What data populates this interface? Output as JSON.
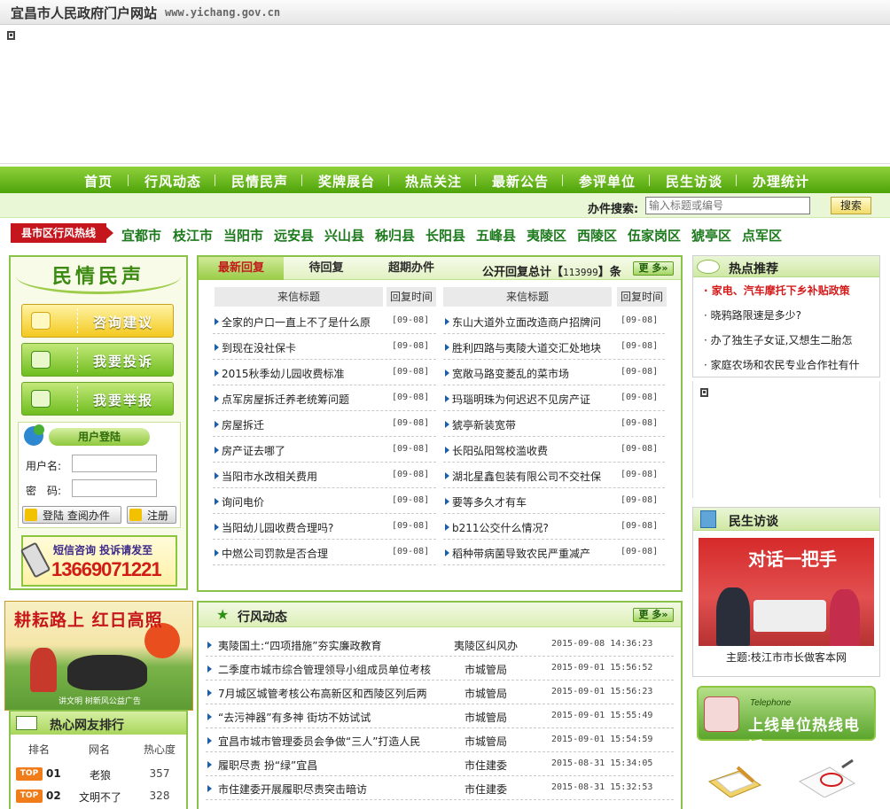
{
  "header": {
    "title": "宜昌市人民政府门户网站",
    "url": "www.yichang.gov.cn"
  },
  "nav": {
    "items": [
      "首页",
      "行风动态",
      "民情民声",
      "奖牌展台",
      "热点关注",
      "最新公告",
      "参评单位",
      "民生访谈",
      "办理统计"
    ]
  },
  "search": {
    "label": "办件搜索:",
    "placeholder": "输入标题或编号",
    "button": "搜索"
  },
  "county": {
    "tag": "县市区行风热线",
    "items": [
      "宜都市",
      "枝江市",
      "当阳市",
      "远安县",
      "兴山县",
      "秭归县",
      "长阳县",
      "五峰县",
      "夷陵区",
      "西陵区",
      "伍家岗区",
      "猇亭区",
      "点军区"
    ]
  },
  "left": {
    "title": "民情民声",
    "buttons": [
      "咨询建议",
      "我要投诉",
      "我要举报"
    ],
    "login": {
      "title": "用户登陆",
      "username_label": "用户名:",
      "password_label": "密　码:",
      "query_button": "登陆 查阅办件",
      "register_button": "注册"
    },
    "sms": {
      "line1": "短信咨询 投诉请发至",
      "number": "13669071221"
    },
    "poster": {
      "title": "耕耘路上 红日高照",
      "footer": "讲文明 树新风公益广告"
    }
  },
  "ranking": {
    "title": "热心网友排行",
    "columns": [
      "排名",
      "网名",
      "热心度"
    ],
    "badge": "TOP",
    "rows": [
      {
        "rank": "01",
        "name": "老狼",
        "score": "357"
      },
      {
        "rank": "02",
        "name": "文明不了",
        "score": "328"
      }
    ]
  },
  "letters": {
    "tabs": [
      "最新回复",
      "待回复",
      "超期办件"
    ],
    "total_prefix": "公开回复总计【",
    "total": "113999",
    "total_suffix": "】条",
    "more": "更 多»",
    "head_title": "来信标题",
    "head_time": "回复时间",
    "left": [
      {
        "title": "全家的户口一直上不了是什么原",
        "date": "[09-08]"
      },
      {
        "title": "到现在没社保卡",
        "date": "[09-08]"
      },
      {
        "title": "2015秋季幼儿园收费标准",
        "date": "[09-08]"
      },
      {
        "title": "点军房屋拆迁养老统筹问题",
        "date": "[09-08]"
      },
      {
        "title": "房屋拆迁",
        "date": "[09-08]"
      },
      {
        "title": "房产证去哪了",
        "date": "[09-08]"
      },
      {
        "title": "当阳市水改相关费用",
        "date": "[09-08]"
      },
      {
        "title": "询问电价",
        "date": "[09-08]"
      },
      {
        "title": "当阳幼儿园收费合理吗?",
        "date": "[09-08]"
      },
      {
        "title": "中燃公司罚款是否合理",
        "date": "[09-08]"
      }
    ],
    "right": [
      {
        "title": "东山大道外立面改造商户招牌问",
        "date": "[09-08]"
      },
      {
        "title": "胜利四路与夷陵大道交汇处地块",
        "date": "[09-08]"
      },
      {
        "title": "宽敞马路变菱乱的菜市场",
        "date": "[09-08]"
      },
      {
        "title": "玛瑙明珠为何迟迟不见房产证",
        "date": "[09-08]"
      },
      {
        "title": "猇亭新装宽带",
        "date": "[09-08]"
      },
      {
        "title": "长阳弘阳驾校滥收费",
        "date": "[09-08]"
      },
      {
        "title": "湖北星鑫包装有限公司不交社保",
        "date": "[09-08]"
      },
      {
        "title": "要等多久才有车",
        "date": "[09-08]"
      },
      {
        "title": "b211公交什么情况?",
        "date": "[09-08]"
      },
      {
        "title": "稻种带病菌导致农民严重减产",
        "date": "[09-08]"
      }
    ]
  },
  "hangfeng": {
    "title": "行风动态",
    "more": "更 多»",
    "rows": [
      {
        "title": "夷陵国土:“四项措施”夯实廉政教育",
        "dept": "夷陵区纠风办",
        "time": "2015-09-08 14:36:23"
      },
      {
        "title": "二季度市城市综合管理领导小组成员单位考核",
        "dept": "市城管局",
        "time": "2015-09-01 15:56:52"
      },
      {
        "title": "7月城区城管考核公布高新区和西陵区列后两",
        "dept": "市城管局",
        "time": "2015-09-01 15:56:23"
      },
      {
        "title": "“去污神器”有多神 街坊不妨试试",
        "dept": "市城管局",
        "time": "2015-09-01 15:55:49"
      },
      {
        "title": "宜昌市城市管理委员会争做“三人”打造人民",
        "dept": "市城管局",
        "time": "2015-09-01 15:54:59"
      },
      {
        "title": "履职尽责 扮“绿”宜昌",
        "dept": "市住建委",
        "time": "2015-08-31 15:34:05"
      },
      {
        "title": "市住建委开展履职尽责突击暗访",
        "dept": "市住建委",
        "time": "2015-08-31 15:32:53"
      }
    ]
  },
  "hot": {
    "title": "热点推荐",
    "items": [
      "家电、汽车摩托下乡补贴政策",
      "晓鸦路限速是多少?",
      "办了独生子女证,又想生二胎怎",
      "家庭农场和农民专业合作社有什"
    ]
  },
  "interview": {
    "title": "民生访谈",
    "logo": "对话一把手",
    "caption": "主题:枝江市市长做客本网"
  },
  "telephone": {
    "en": "Telephone",
    "cn": "上线单位热线电话"
  },
  "colors": {
    "nav_green": "#4ea30a",
    "county_red": "#c4161c",
    "link_green": "#1d7a1d",
    "hot_red": "#d41b1b"
  }
}
